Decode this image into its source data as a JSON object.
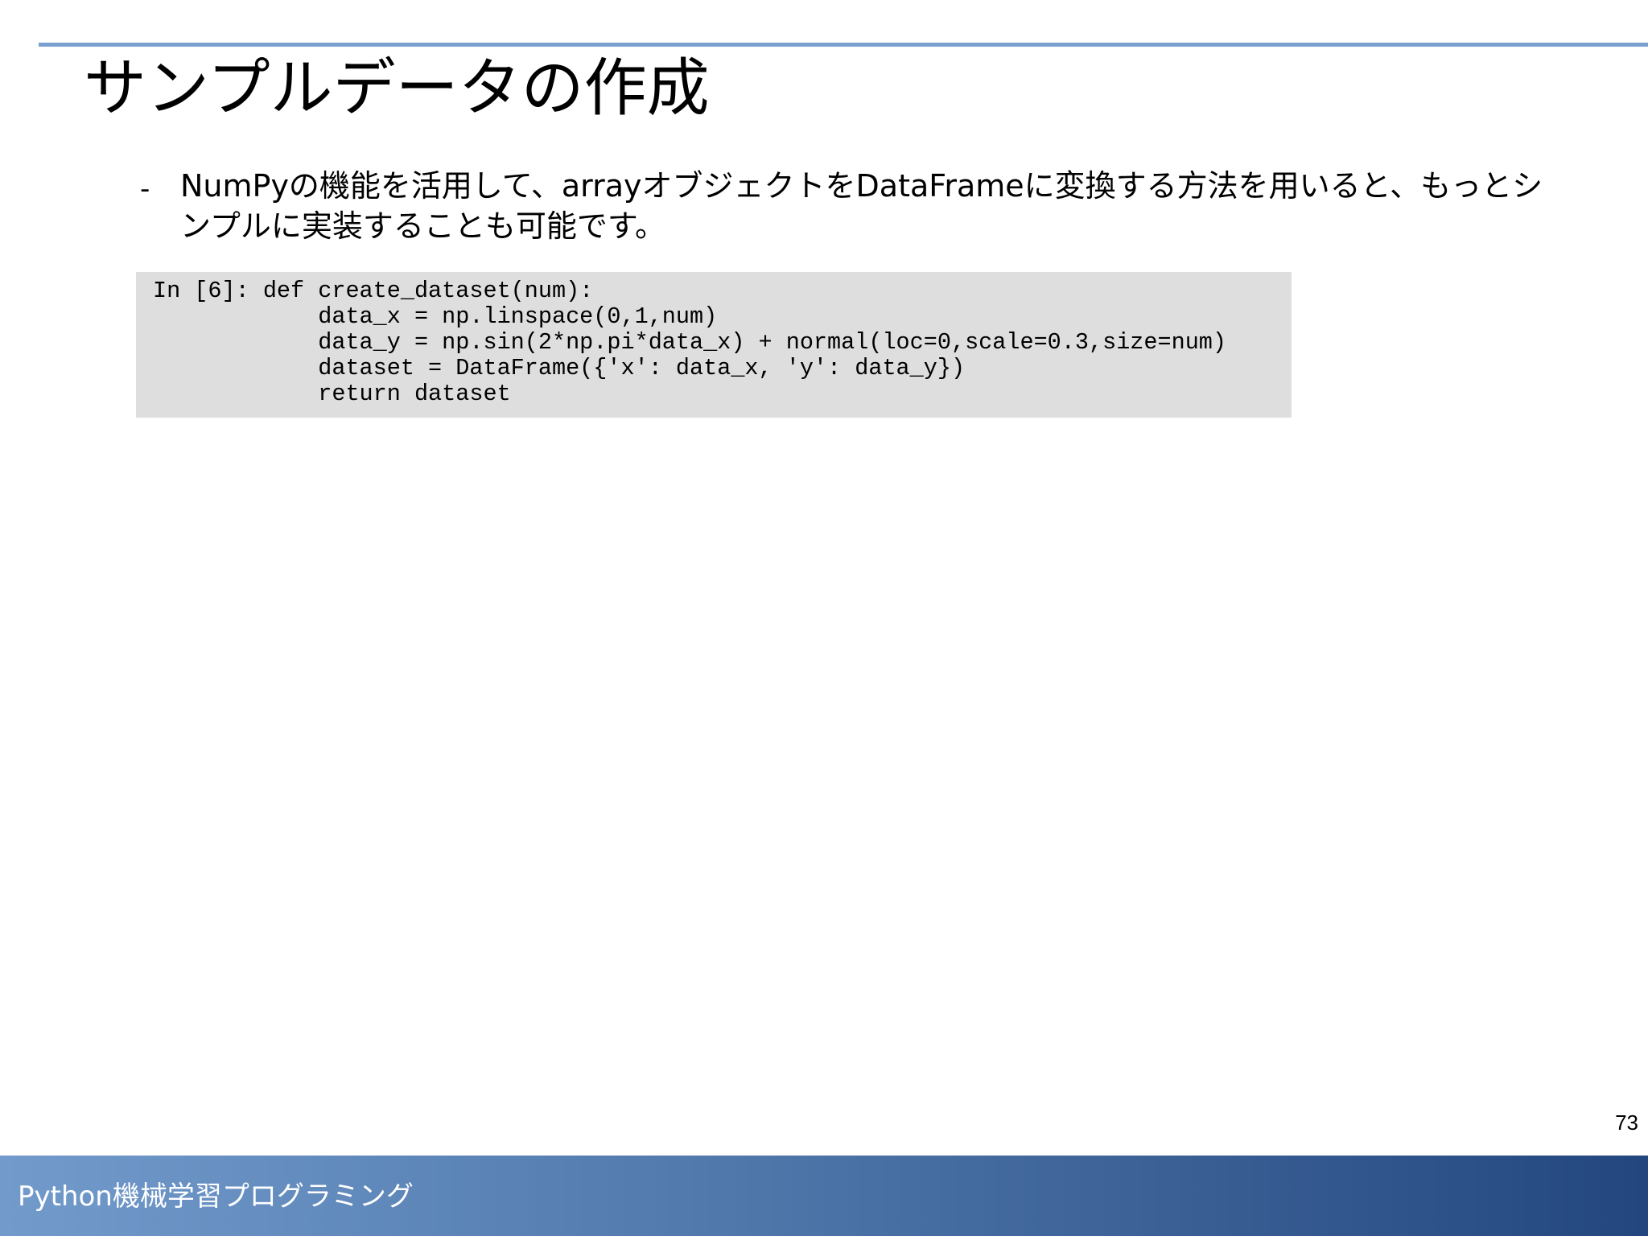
{
  "slide": {
    "title": "サンプルデータの作成",
    "bullets": [
      {
        "marker": "-",
        "text": "NumPyの機能を活用して、arrayオブジェクトをDataFrameに変換する方法を用いると、もっとシンプルに実装することも可能です。"
      }
    ],
    "code": {
      "lines": [
        "In [6]: def create_dataset(num):",
        "            data_x = np.linspace(0,1,num)",
        "            data_y = np.sin(2*np.pi*data_x) + normal(loc=0,scale=0.3,size=num)",
        "            dataset = DataFrame({'x': data_x, 'y': data_y})",
        "            return dataset"
      ]
    },
    "page_number": "73"
  },
  "footer": {
    "text": "Python機械学習プログラミング"
  },
  "colors": {
    "rule": "#7aa0cf",
    "footer_gradient_start": "#729bcc",
    "footer_gradient_end": "#23467f",
    "code_background": "#dedede"
  }
}
